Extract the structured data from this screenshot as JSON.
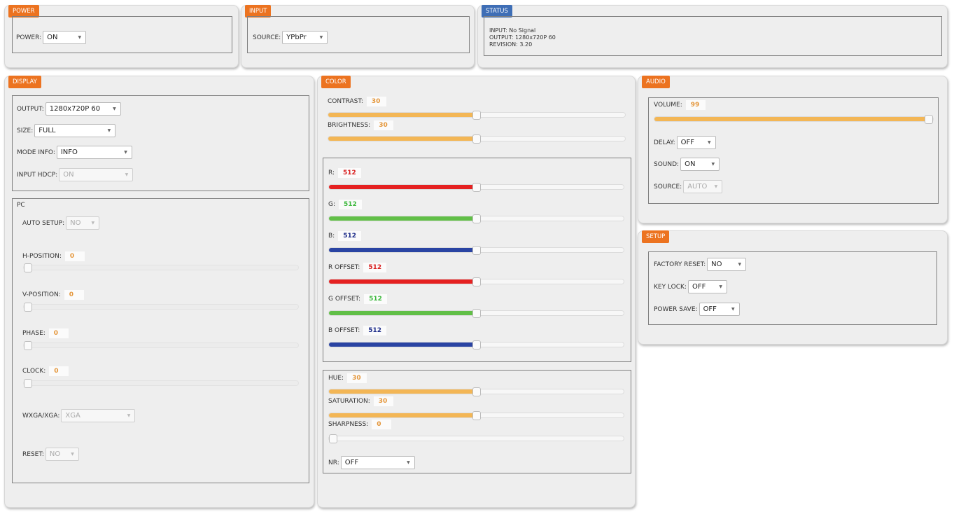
{
  "power": {
    "tab": "POWER",
    "label": "POWER:",
    "value": "ON"
  },
  "input": {
    "tab": "INPUT",
    "label": "SOURCE:",
    "value": "YPbPr"
  },
  "status": {
    "tab": "STATUS",
    "input_line": "INPUT: No Signal",
    "output_line": "OUTPUT: 1280x720P 60",
    "revision_line": "REVISION: 3.20"
  },
  "display": {
    "tab": "DISPLAY",
    "output_label": "OUTPUT:",
    "output_value": "1280x720P 60",
    "size_label": "SIZE:",
    "size_value": "FULL",
    "mode_label": "MODE INFO:",
    "mode_value": "INFO",
    "hdcp_label": "INPUT HDCP:",
    "hdcp_value": "ON",
    "pc": {
      "title": "PC",
      "auto_label": "AUTO SETUP:",
      "auto_value": "NO",
      "hpos_label": "H-POSITION:",
      "hpos_value": "0",
      "vpos_label": "V-POSITION:",
      "vpos_value": "0",
      "phase_label": "PHASE:",
      "phase_value": "0",
      "clock_label": "CLOCK:",
      "clock_value": "0",
      "wxga_label": "WXGA/XGA:",
      "wxga_value": "XGA",
      "reset_label": "RESET:",
      "reset_value": "NO"
    }
  },
  "color": {
    "tab": "COLOR",
    "contrast_label": "CONTRAST:",
    "contrast_value": "30",
    "contrast_level": 0.5,
    "brightness_label": "BRIGHTNESS:",
    "brightness_value": "30",
    "brightness_level": 0.5,
    "r_label": "R:",
    "r_value": "512",
    "r_level": 0.5,
    "g_label": "G:",
    "g_value": "512",
    "g_level": 0.5,
    "b_label": "B:",
    "b_value": "512",
    "b_level": 0.5,
    "roffset_label": "R OFFSET:",
    "roffset_value": "512",
    "roffset_level": 0.5,
    "goffset_label": "G OFFSET:",
    "goffset_value": "512",
    "goffset_level": 0.5,
    "boffset_label": "B OFFSET:",
    "boffset_value": "512",
    "boffset_level": 0.5,
    "hue_label": "HUE:",
    "hue_value": "30",
    "hue_level": 0.5,
    "saturation_label": "SATURATION:",
    "saturation_value": "30",
    "saturation_level": 0.5,
    "sharpness_label": "SHARPNESS:",
    "sharpness_value": "0",
    "sharpness_level": 0,
    "nr_label": "NR:",
    "nr_value": "OFF"
  },
  "audio": {
    "tab": "AUDIO",
    "volume_label": "VOLUME:",
    "volume_value": "99",
    "volume_level": 1.0,
    "delay_label": "DELAY:",
    "delay_value": "OFF",
    "sound_label": "SOUND:",
    "sound_value": "ON",
    "source_label": "SOURCE:",
    "source_value": "AUTO"
  },
  "setup": {
    "tab": "SETUP",
    "factory_label": "FACTORY RESET:",
    "factory_value": "NO",
    "keylock_label": "KEY LOCK:",
    "keylock_value": "OFF",
    "powersave_label": "POWER SAVE:",
    "powersave_value": "OFF"
  },
  "colors": {
    "accent_tab": "#ec7320",
    "status_tab": "#3e6eb6",
    "slider_fill": "#f3b655",
    "red": "#e52121",
    "green": "#61bf47",
    "blue": "#2a44a3"
  }
}
